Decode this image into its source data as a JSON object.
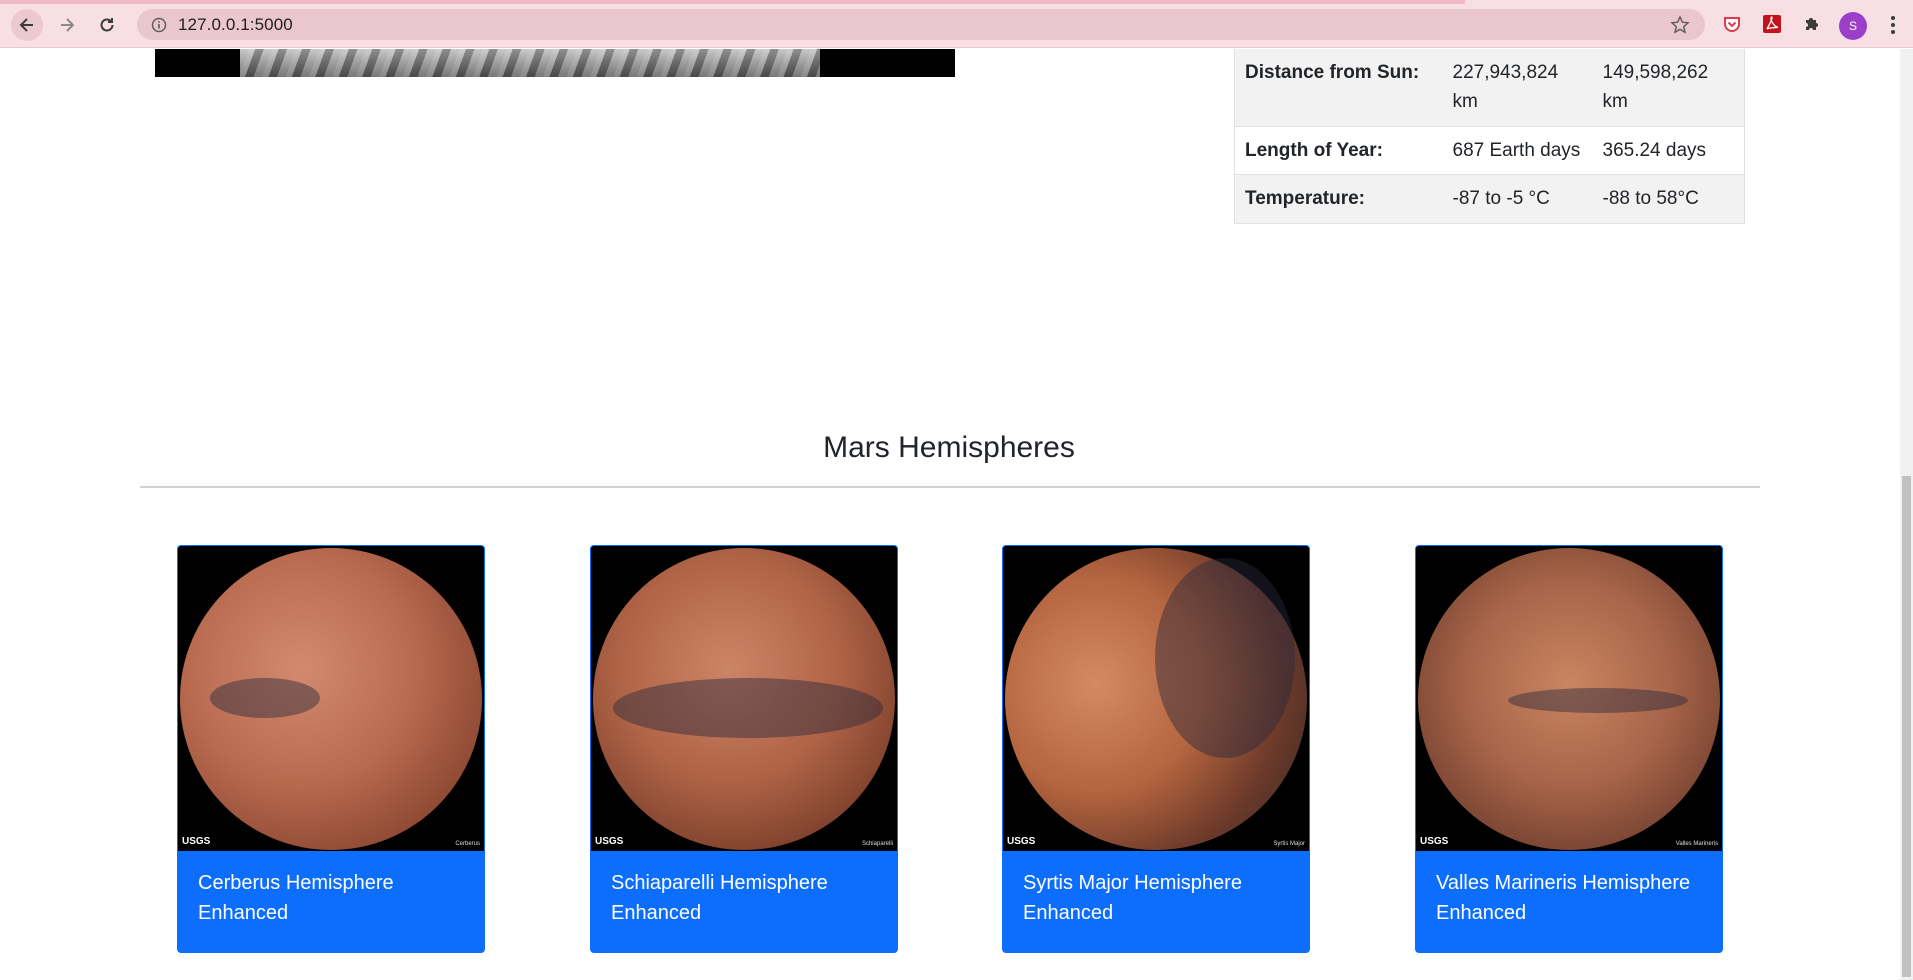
{
  "browser": {
    "url": "127.0.0.1:5000",
    "profile_initial": "S"
  },
  "facts": {
    "rows": [
      {
        "label": "Distance from Sun:",
        "mars": "227,943,824 km",
        "earth": "149,598,262 km"
      },
      {
        "label": "Length of Year:",
        "mars": "687 Earth days",
        "earth": "365.24 days"
      },
      {
        "label": "Temperature:",
        "mars": "-87 to -5 °C",
        "earth": "-88 to 58°C"
      }
    ]
  },
  "hemispheres": {
    "title": "Mars Hemispheres",
    "items": [
      {
        "title": "Cerberus Hemisphere Enhanced",
        "img_label": "Cerberus"
      },
      {
        "title": "Schiaparelli Hemisphere Enhanced",
        "img_label": "Schiaparelli"
      },
      {
        "title": "Syrtis Major Hemisphere Enhanced",
        "img_label": "Syrtis Major"
      },
      {
        "title": "Valles Marineris Hemisphere Enhanced",
        "img_label": "Valles Marineris"
      }
    ],
    "watermark": "USGS"
  },
  "colors": {
    "card_blue": "#0d6efd",
    "chrome_bar": "#f7dfe4"
  },
  "icons": [
    "back-icon",
    "forward-icon",
    "reload-icon",
    "info-icon",
    "star-icon",
    "pocket-icon",
    "pdf-icon",
    "puzzle-icon",
    "menu-dots-icon"
  ]
}
